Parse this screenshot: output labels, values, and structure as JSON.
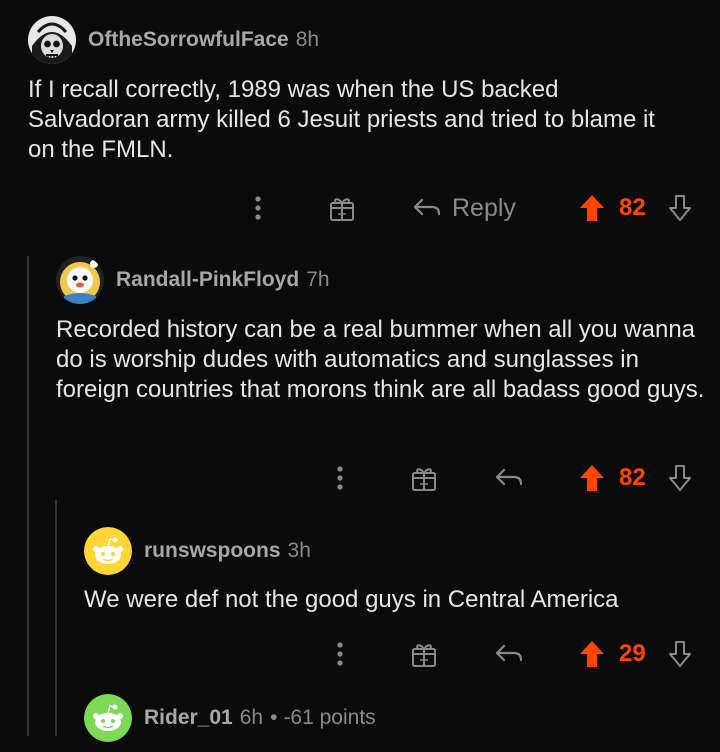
{
  "colors": {
    "background": "#0b0b0b",
    "username": "#a8a8a8",
    "meta": "#8a8a8a",
    "body_text": "#e4e6e8",
    "upvote": "#ff4500",
    "thread_line": "#343536"
  },
  "comments": [
    {
      "username": "OftheSorrowfulFace",
      "age": "8h",
      "avatar_icon": "skull-avatar-icon",
      "body": "If I recall correctly, 1989 was when the US backed Salvadoran army killed 6 Jesuit priests and tried to blame it on the FMLN.",
      "actions": {
        "more_icon": "more-options-icon",
        "award_icon": "award-gift-icon",
        "reply_icon": "reply-arrow-icon",
        "reply_label": "Reply",
        "upvote_icon": "upvote-arrow-icon",
        "score": "82",
        "downvote_icon": "downvote-arrow-icon"
      }
    },
    {
      "username": "Randall-PinkFloyd",
      "age": "7h",
      "avatar_icon": "cartoon-avatar-icon",
      "body": "Recorded history can be a real bummer when all you wanna do is worship dudes with automatics and sunglasses in foreign countries that morons think are all badass good guys.",
      "actions": {
        "more_icon": "more-options-icon",
        "award_icon": "award-gift-icon",
        "reply_icon": "reply-arrow-icon",
        "upvote_icon": "upvote-arrow-icon",
        "score": "82",
        "downvote_icon": "downvote-arrow-icon"
      }
    },
    {
      "username": "runswspoons",
      "age": "3h",
      "avatar_icon": "snoo-yellow-avatar-icon",
      "body": "We were def not the good guys in Central America",
      "actions": {
        "more_icon": "more-options-icon",
        "award_icon": "award-gift-icon",
        "reply_icon": "reply-arrow-icon",
        "upvote_icon": "upvote-arrow-icon",
        "score": "29",
        "downvote_icon": "downvote-arrow-icon"
      }
    },
    {
      "username": "Rider_01",
      "age": "6h",
      "separator": "•",
      "points": "-61 points",
      "avatar_icon": "snoo-green-avatar-icon"
    }
  ]
}
